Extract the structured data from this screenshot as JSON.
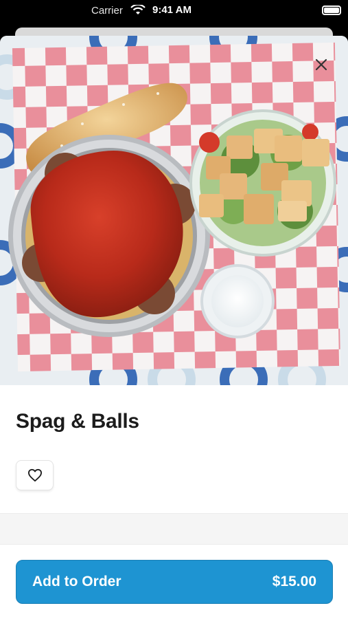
{
  "status_bar": {
    "carrier": "Carrier",
    "time": "9:41 AM"
  },
  "item": {
    "title": "Spag & Balls",
    "image_icon": "food-photo"
  },
  "actions": {
    "favorite_icon": "heart-icon",
    "close_icon": "close-icon",
    "add_to_order_label": "Add to Order",
    "price": "$15.00"
  },
  "colors": {
    "accent": "#1e94d2",
    "title": "#1c1c1c"
  }
}
